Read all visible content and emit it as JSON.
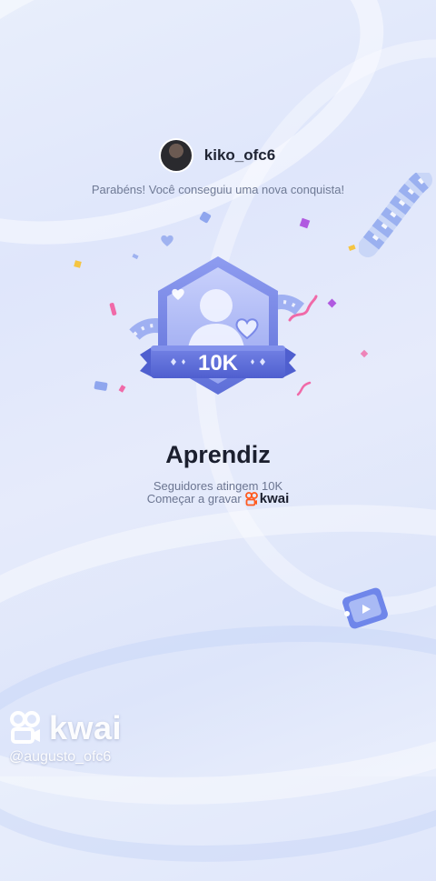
{
  "profile": {
    "username": "kiko_ofc6",
    "message": "Parabéns! Você conseguiu uma nova conquista!"
  },
  "achievement": {
    "badge_value": "10K",
    "title": "Aprendiz",
    "description": "Seguidores atingem 10K",
    "cta_text": "Começar a gravar",
    "brand": "kwai"
  },
  "watermark": {
    "brand": "kwai",
    "handle": "@augusto_ofc6"
  },
  "colors": {
    "badge_primary": "#6f7fe0",
    "badge_light": "#b9c3f5",
    "brand_orange": "#ff5a1f",
    "confetti_pink": "#f06aa8",
    "confetti_purple": "#b05ae0",
    "confetti_yellow": "#f5c542"
  }
}
